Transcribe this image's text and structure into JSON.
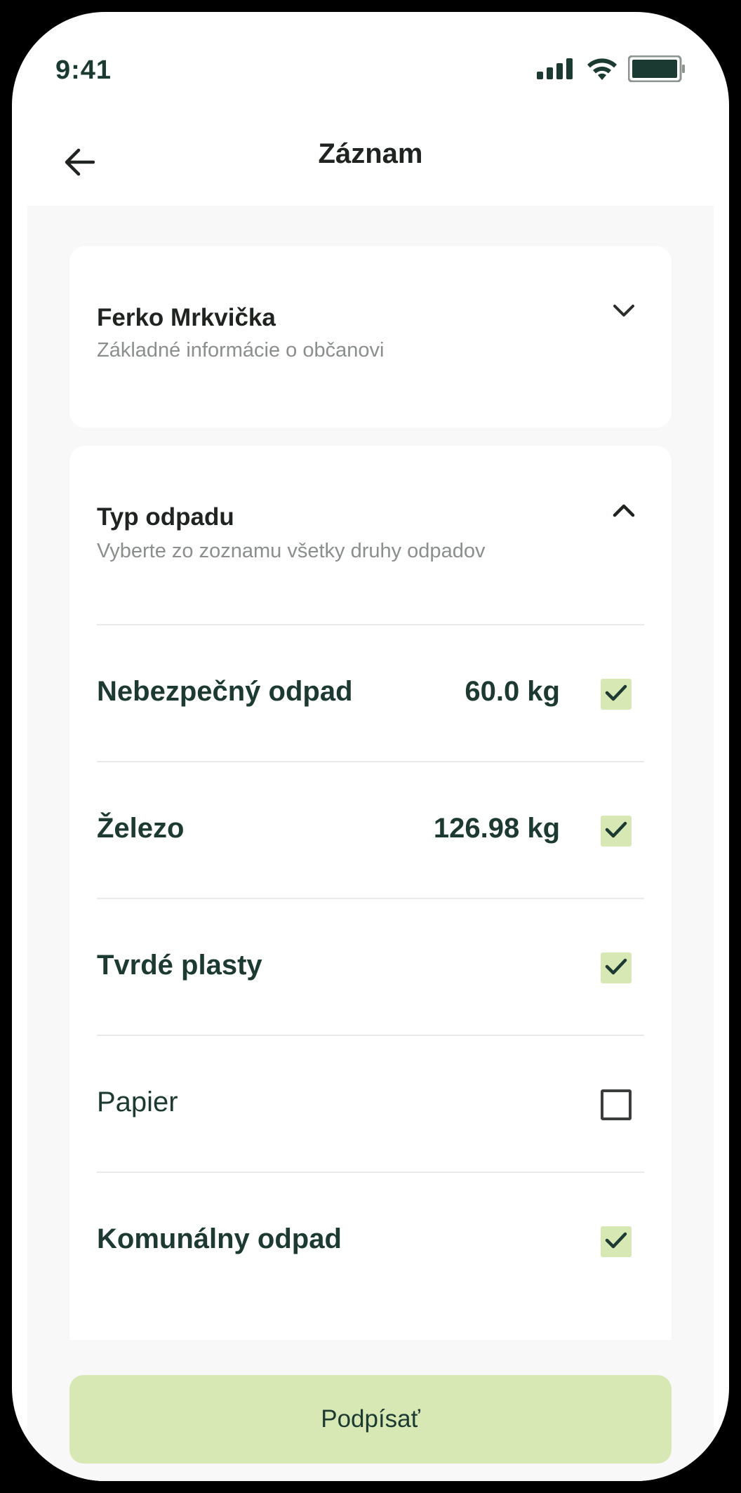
{
  "status_bar": {
    "time": "9:41",
    "icons": [
      "signal-icon",
      "wifi-icon",
      "battery-icon"
    ]
  },
  "header": {
    "title": "Záznam",
    "back_icon": "arrow-left-icon"
  },
  "citizen_card": {
    "title": "Ferko Mrkvička",
    "subtitle": "Základné informácie o občanovi",
    "expanded": false,
    "icon": "chevron-down-icon"
  },
  "waste_card": {
    "title": "Typ odpadu",
    "subtitle": "Vyberte zo zoznamu všetky druhy odpadov",
    "expanded": true,
    "icon": "chevron-up-icon",
    "items": [
      {
        "label": "Nebezpečný odpad",
        "weight": "60.0 kg",
        "checked": true
      },
      {
        "label": "Železo",
        "weight": "126.98 kg",
        "checked": true
      },
      {
        "label": "Tvrdé plasty",
        "weight": "",
        "checked": true
      },
      {
        "label": "Papier",
        "weight": "",
        "checked": false
      },
      {
        "label": "Komunálny odpad",
        "weight": "",
        "checked": true
      }
    ]
  },
  "footer": {
    "sign_button_label": "Podpísať"
  },
  "colors": {
    "accent": "#d7e8b4",
    "text_dark_green": "#1c3a32",
    "background": "#f8f8f8"
  }
}
